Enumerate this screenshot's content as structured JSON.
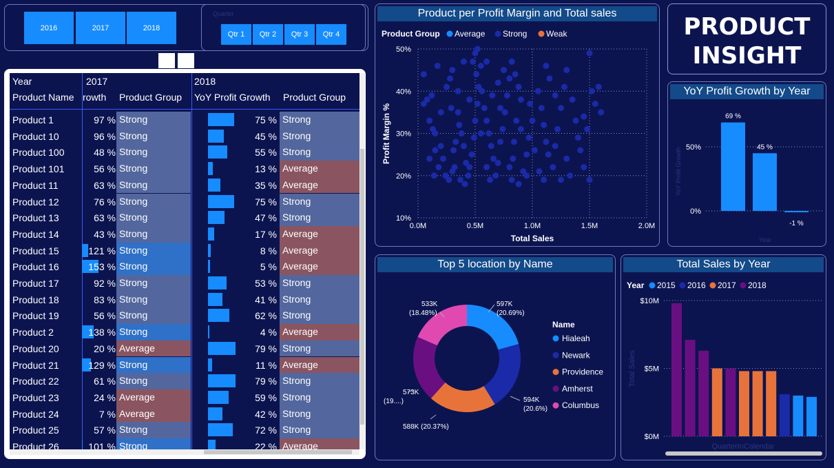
{
  "year_slicer": {
    "years": [
      "2016",
      "2017",
      "2018"
    ]
  },
  "quarter_slicer": {
    "title": "Quarter",
    "quarters": [
      "Qtr 1",
      "Qtr 2",
      "Qtr 3",
      "Qtr 4"
    ]
  },
  "table": {
    "year_2017": "2017",
    "year_2018": "2018",
    "col_year": "Year",
    "col_product_name": "Product Name",
    "col_growth_2017": "rowth",
    "col_group_2017": "Product Group",
    "col_growth_2018": "YoY Profit Growth",
    "col_group_2018": "Product Group",
    "rows": [
      {
        "name": "Product 1",
        "g17": "97 %",
        "v17": 97,
        "grp17": "Strong",
        "g18": "75 %",
        "v18": 75,
        "grp18": "Strong"
      },
      {
        "name": "Product 10",
        "g17": "96 %",
        "v17": 96,
        "grp17": "Strong",
        "g18": "45 %",
        "v18": 45,
        "grp18": "Strong"
      },
      {
        "name": "Product 100",
        "g17": "48 %",
        "v17": 48,
        "grp17": "Strong",
        "g18": "55 %",
        "v18": 55,
        "grp18": "Strong"
      },
      {
        "name": "Product 101",
        "g17": "56 %",
        "v17": 56,
        "grp17": "Strong",
        "g18": "13 %",
        "v18": 13,
        "grp18": "Average"
      },
      {
        "name": "Product 11",
        "g17": "63 %",
        "v17": 63,
        "grp17": "Strong",
        "g18": "35 %",
        "v18": 35,
        "grp18": "Average"
      },
      {
        "name": "Product 12",
        "g17": "76 %",
        "v17": 76,
        "grp17": "Strong",
        "g18": "75 %",
        "v18": 75,
        "grp18": "Strong"
      },
      {
        "name": "Product 13",
        "g17": "63 %",
        "v17": 63,
        "grp17": "Strong",
        "g18": "47 %",
        "v18": 47,
        "grp18": "Strong"
      },
      {
        "name": "Product 14",
        "g17": "43 %",
        "v17": 43,
        "grp17": "Strong",
        "g18": "17 %",
        "v18": 17,
        "grp18": "Average"
      },
      {
        "name": "Product 15",
        "g17": "121 %",
        "v17": 121,
        "grp17": "Strong",
        "g18": "8 %",
        "v18": 8,
        "grp18": "Average"
      },
      {
        "name": "Product 16",
        "g17": "153 %",
        "v17": 153,
        "grp17": "Strong",
        "g18": "5 %",
        "v18": 5,
        "grp18": "Average"
      },
      {
        "name": "Product 17",
        "g17": "92 %",
        "v17": 92,
        "grp17": "Strong",
        "g18": "53 %",
        "v18": 53,
        "grp18": "Strong"
      },
      {
        "name": "Product 18",
        "g17": "83 %",
        "v17": 83,
        "grp17": "Strong",
        "g18": "41 %",
        "v18": 41,
        "grp18": "Strong"
      },
      {
        "name": "Product 19",
        "g17": "56 %",
        "v17": 56,
        "grp17": "Strong",
        "g18": "62 %",
        "v18": 62,
        "grp18": "Strong"
      },
      {
        "name": "Product 2",
        "g17": "138 %",
        "v17": 138,
        "grp17": "Strong",
        "g18": "4 %",
        "v18": 4,
        "grp18": "Average"
      },
      {
        "name": "Product 20",
        "g17": "20 %",
        "v17": 20,
        "grp17": "Average",
        "g18": "79 %",
        "v18": 79,
        "grp18": "Strong"
      },
      {
        "name": "Product 21",
        "g17": "129 %",
        "v17": 129,
        "grp17": "Strong",
        "g18": "11 %",
        "v18": 11,
        "grp18": "Average"
      },
      {
        "name": "Product 22",
        "g17": "61 %",
        "v17": 61,
        "grp17": "Strong",
        "g18": "79 %",
        "v18": 79,
        "grp18": "Strong"
      },
      {
        "name": "Product 23",
        "g17": "24 %",
        "v17": 24,
        "grp17": "Average",
        "g18": "59 %",
        "v18": 59,
        "grp18": "Strong"
      },
      {
        "name": "Product 24",
        "g17": "7 %",
        "v17": 7,
        "grp17": "Average",
        "g18": "42 %",
        "v18": 42,
        "grp18": "Strong"
      },
      {
        "name": "Product 25",
        "g17": "57 %",
        "v17": 57,
        "grp17": "Strong",
        "g18": "72 %",
        "v18": 72,
        "grp18": "Strong"
      },
      {
        "name": "Product 26",
        "g17": "101 %",
        "v17": 101,
        "grp17": "Strong",
        "g18": "22 %",
        "v18": 22,
        "grp18": "Average"
      }
    ],
    "colors": {
      "strong": "#53679e",
      "strong_bright": "#2f70c8",
      "average": "#8a5560"
    }
  },
  "insight": {
    "title": "PRODUCT INSIGHT"
  },
  "chart_data": [
    {
      "type": "scatter",
      "title": "Product per Profit Margin and Total sales",
      "legend_title": "Product Group",
      "legend_position": "top-left",
      "legend": [
        {
          "name": "Average",
          "color": "#168cff"
        },
        {
          "name": "Strong",
          "color": "#1a2aa8"
        },
        {
          "name": "Weak",
          "color": "#e8733a"
        }
      ],
      "xlabel": "Total Sales",
      "ylabel": "Profit Margin %",
      "xlim": [
        0,
        2.0
      ],
      "ylim": [
        10,
        50
      ],
      "x_ticks": [
        "0.0M",
        "0.5M",
        "1.0M",
        "1.5M",
        "2.0M"
      ],
      "y_ticks": [
        "10%",
        "20%",
        "30%",
        "40%",
        "50%"
      ],
      "grid": true,
      "points": [
        [
          0.05,
          44
        ],
        [
          0.08,
          38
        ],
        [
          0.05,
          37
        ],
        [
          0.1,
          33
        ],
        [
          0.12,
          39
        ],
        [
          0.13,
          31
        ],
        [
          0.15,
          30
        ],
        [
          0.17,
          46
        ],
        [
          0.2,
          27
        ],
        [
          0.22,
          24
        ],
        [
          0.18,
          22
        ],
        [
          0.24,
          20
        ],
        [
          0.27,
          19
        ],
        [
          0.3,
          21
        ],
        [
          0.31,
          26
        ],
        [
          0.33,
          28
        ],
        [
          0.29,
          36
        ],
        [
          0.28,
          43
        ],
        [
          0.35,
          35
        ],
        [
          0.36,
          32
        ],
        [
          0.38,
          30
        ],
        [
          0.4,
          27
        ],
        [
          0.42,
          23
        ],
        [
          0.44,
          20
        ],
        [
          0.37,
          19
        ],
        [
          0.41,
          18
        ],
        [
          0.45,
          22
        ],
        [
          0.47,
          25
        ],
        [
          0.49,
          29
        ],
        [
          0.5,
          33
        ],
        [
          0.52,
          37
        ],
        [
          0.53,
          41
        ],
        [
          0.51,
          44
        ],
        [
          0.55,
          46
        ],
        [
          0.5,
          49
        ],
        [
          0.52,
          50
        ],
        [
          0.48,
          47
        ],
        [
          0.56,
          40
        ],
        [
          0.58,
          36
        ],
        [
          0.6,
          33
        ],
        [
          0.62,
          30
        ],
        [
          0.64,
          27
        ],
        [
          0.66,
          24
        ],
        [
          0.6,
          22
        ],
        [
          0.63,
          19
        ],
        [
          0.68,
          20
        ],
        [
          0.7,
          23
        ],
        [
          0.72,
          28
        ],
        [
          0.74,
          31
        ],
        [
          0.76,
          35
        ],
        [
          0.78,
          39
        ],
        [
          0.8,
          43
        ],
        [
          0.75,
          45
        ],
        [
          0.82,
          47
        ],
        [
          0.85,
          44
        ],
        [
          0.88,
          41
        ],
        [
          0.9,
          38
        ],
        [
          0.86,
          33
        ],
        [
          0.84,
          28
        ],
        [
          0.83,
          24
        ],
        [
          0.8,
          22
        ],
        [
          0.82,
          19
        ],
        [
          0.92,
          21
        ],
        [
          0.95,
          25
        ],
        [
          0.97,
          29
        ],
        [
          1.0,
          33
        ],
        [
          0.98,
          37
        ],
        [
          1.05,
          40
        ],
        [
          1.08,
          36
        ],
        [
          1.1,
          32
        ],
        [
          1.12,
          28
        ],
        [
          1.14,
          25
        ],
        [
          1.06,
          21
        ],
        [
          1.1,
          19
        ],
        [
          1.18,
          22
        ],
        [
          1.2,
          27
        ],
        [
          1.22,
          31
        ],
        [
          1.25,
          36
        ],
        [
          1.28,
          41
        ],
        [
          1.3,
          45
        ],
        [
          1.12,
          46
        ],
        [
          1.15,
          43
        ],
        [
          1.35,
          38
        ],
        [
          1.38,
          33
        ],
        [
          1.4,
          29
        ],
        [
          1.42,
          26
        ],
        [
          1.45,
          22
        ],
        [
          1.5,
          19
        ],
        [
          1.48,
          31
        ],
        [
          1.55,
          37
        ],
        [
          1.52,
          40
        ],
        [
          1.6,
          35
        ],
        [
          1.58,
          41
        ],
        [
          1.5,
          49
        ],
        [
          0.25,
          41
        ],
        [
          0.2,
          35
        ],
        [
          0.15,
          26
        ],
        [
          0.1,
          24
        ],
        [
          0.14,
          20
        ],
        [
          0.3,
          45
        ],
        [
          0.35,
          40
        ],
        [
          0.45,
          38
        ],
        [
          0.55,
          30
        ],
        [
          0.65,
          39
        ],
        [
          0.7,
          42
        ],
        [
          0.72,
          36
        ],
        [
          0.9,
          31
        ],
        [
          0.95,
          20
        ],
        [
          1.02,
          26
        ],
        [
          1.3,
          24
        ],
        [
          1.33,
          20
        ],
        [
          1.45,
          34
        ],
        [
          0.6,
          47
        ],
        [
          0.4,
          47
        ],
        [
          1.2,
          39
        ],
        [
          1.25,
          19
        ],
        [
          0.88,
          18
        ],
        [
          0.32,
          22
        ]
      ]
    },
    {
      "type": "bar",
      "title": "YoY Profit Growth by Year",
      "xlabel": "Year",
      "ylabel": "YoY Profit Growth",
      "ylim": [
        -10,
        80
      ],
      "y_ticks": [
        "0%",
        "50%"
      ],
      "values": [
        69,
        45,
        -1
      ],
      "labels": [
        "69 %",
        "45 %",
        "-1 %"
      ],
      "color": "#168cff"
    },
    {
      "type": "pie",
      "title": "Top 5 location by Name",
      "legend_title": "Name",
      "legend_position": "right",
      "slices": [
        {
          "name": "Hialeah",
          "value": 597,
          "label": "597K",
          "pct": "(20.69%)",
          "color": "#168cff"
        },
        {
          "name": "Newark",
          "value": 594,
          "label": "594K",
          "pct": "(20.6%)",
          "color": "#1a2aa8"
        },
        {
          "name": "Providence",
          "value": 588,
          "label": "588K (20.37%)",
          "pct": "",
          "color": "#e8733a"
        },
        {
          "name": "Amherst",
          "value": 573,
          "label": "573K",
          "pct": "(19....)",
          "color": "#6a0f82"
        },
        {
          "name": "Columbus",
          "value": 533,
          "label": "533K",
          "pct": "(18.48%)",
          "color": "#e04ab0"
        }
      ]
    },
    {
      "type": "bar",
      "title": "Total Sales by Year",
      "legend_title": "Year",
      "legend_position": "top-left",
      "legend": [
        {
          "name": "2015",
          "color": "#168cff"
        },
        {
          "name": "2016",
          "color": "#1a2aa8"
        },
        {
          "name": "2017",
          "color": "#e8733a"
        },
        {
          "name": "2018",
          "color": "#6a0f82"
        }
      ],
      "xlabel": "QuarterInCalendar",
      "ylabel": "Total Sales",
      "y_ticks": [
        "$0M",
        "$5M",
        "$10M"
      ],
      "ylim": [
        0,
        10
      ],
      "bars": [
        {
          "value": 9.8,
          "series": "2018"
        },
        {
          "value": 7.1,
          "series": "2018"
        },
        {
          "value": 6.3,
          "series": "2018"
        },
        {
          "value": 5.0,
          "series": "2017"
        },
        {
          "value": 5.0,
          "series": "2018"
        },
        {
          "value": 4.8,
          "series": "2017"
        },
        {
          "value": 4.8,
          "series": "2017"
        },
        {
          "value": 4.8,
          "series": "2017"
        },
        {
          "value": 3.1,
          "series": "2016"
        },
        {
          "value": 3.0,
          "series": "2015"
        },
        {
          "value": 2.9,
          "series": "2015"
        }
      ]
    }
  ]
}
